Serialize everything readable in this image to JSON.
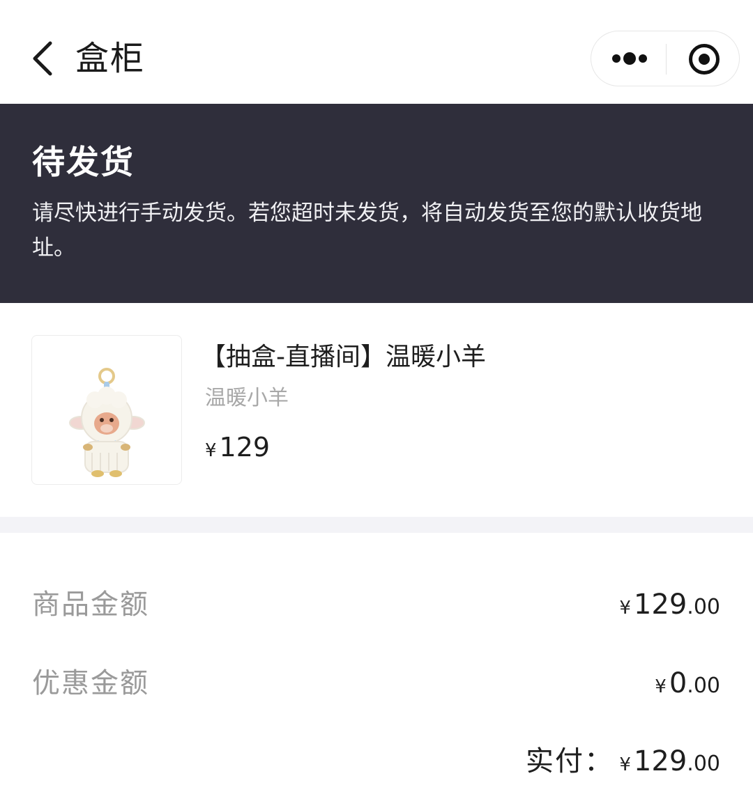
{
  "navbar": {
    "title": "盒柜",
    "back_icon": "chevron-left-icon",
    "more_icon": "more-dots-icon",
    "close_icon": "target-close-icon"
  },
  "status": {
    "title": "待发货",
    "description": "请尽快进行手动发货。若您超时未发货，将自动发货至您的默认收货地址。"
  },
  "product": {
    "name": "【抽盒-直播间】温暖小羊",
    "subtitle": "温暖小羊",
    "currency": "¥",
    "price": "129"
  },
  "summary": {
    "goods_amount": {
      "label": "商品金额",
      "currency": "¥",
      "integer": "129",
      "decimal": ".00"
    },
    "discount_amount": {
      "label": "优惠金额",
      "currency": "¥",
      "integer": "0",
      "decimal": ".00"
    },
    "paid": {
      "label": "实付：",
      "currency": "¥",
      "integer": "129",
      "decimal": ".00"
    }
  },
  "colors": {
    "banner_bg": "#2f2e3b",
    "section_gap": "#f3f3f7",
    "muted_text": "#9a9a9a"
  }
}
